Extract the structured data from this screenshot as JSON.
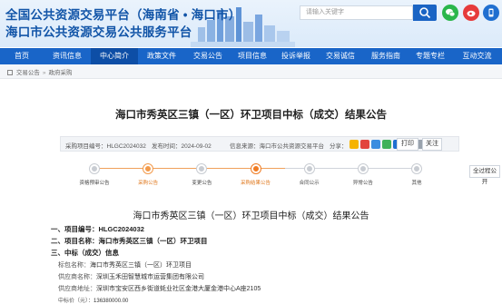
{
  "header": {
    "title_line1": "全国公共资源交易平台（海南省 • 海口市）",
    "title_line2": "海口市公共资源交易公共服务平台",
    "search_placeholder": "请输入关键字",
    "icons": [
      "search-icon",
      "wechat-icon",
      "weibo-icon",
      "app-icon"
    ],
    "accent_color": "#1965c8"
  },
  "nav": {
    "items": [
      {
        "label": "首页",
        "w": 48
      },
      {
        "label": "资讯信息",
        "w": 52
      },
      {
        "label": "中心简介",
        "w": 52,
        "active": true
      },
      {
        "label": "政策文件",
        "w": 52
      },
      {
        "label": "交易公告",
        "w": 50
      },
      {
        "label": "项目信息",
        "w": 48
      },
      {
        "label": "投诉举报",
        "w": 48
      },
      {
        "label": "交易诚信",
        "w": 50
      },
      {
        "label": "服务指南",
        "w": 50
      },
      {
        "label": "专题专栏",
        "w": 48
      },
      {
        "label": "互动交流",
        "w": 55
      }
    ]
  },
  "breadcrumb": [
    "交易公告",
    "政府采购"
  ],
  "page_title": "海口市秀英区三镇（一区）环卫项目中标（成交）结果公告",
  "meta": {
    "project_no_label": "采购项目编号：",
    "project_no": "HLGC2024032",
    "pub_time_label": "发布时间：",
    "pub_time": "2024-09-02",
    "source_label": "信息来源：",
    "source": "海口市公共资源交易平台",
    "share_label": "分享：",
    "print_label": "打印",
    "follow_label": "关注"
  },
  "process": {
    "steps": [
      {
        "label": "资格预审公告",
        "state": "pending"
      },
      {
        "label": "采购公告",
        "state": "done"
      },
      {
        "label": "变更公告",
        "state": "pending"
      },
      {
        "label": "采购结果公告",
        "state": "current"
      },
      {
        "label": "合同公示",
        "state": "pending"
      },
      {
        "label": "异常公告",
        "state": "pending"
      },
      {
        "label": "其他",
        "state": "pending"
      }
    ],
    "full_process_label": "全过程公开"
  },
  "content": {
    "title": "海口市秀英区三镇（一区）环卫项目中标（成交）结果公告",
    "lines": [
      {
        "text": "一、项目编号：HLGC2024032",
        "bold": true
      },
      {
        "text": "二、项目名称：海口市秀英区三镇（一区）环卫项目",
        "bold": true
      },
      {
        "text": "三、中标（成交）信息",
        "bold": true
      }
    ],
    "sub_lines": [
      {
        "key": "标包名称：",
        "value": "海口市秀英区三镇（一区）环卫项目"
      },
      {
        "key": "供应商名称：",
        "value": "深圳玉禾田智慧城市运营集团有限公司"
      },
      {
        "key": "供应商地址：",
        "value": "深圳市宝安区西乡街道蚝业社区金港大厦金港中心A座2105"
      },
      {
        "key": "中标价（元）：",
        "value": "136380000.00"
      }
    ]
  }
}
